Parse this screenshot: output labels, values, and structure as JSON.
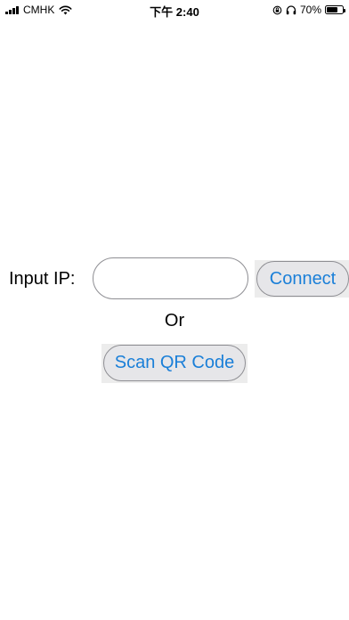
{
  "status_bar": {
    "carrier": "CMHK",
    "time": "下午 2:40",
    "battery_percent": "70%",
    "battery_level": 0.7,
    "icons": [
      "signal-icon",
      "wifi-icon",
      "orientation-lock-icon",
      "headphones-icon",
      "battery-icon"
    ]
  },
  "connect_form": {
    "ip_label": "Input IP:",
    "ip_value": "",
    "connect_label": "Connect"
  },
  "or_label": "Or",
  "scan_label": "Scan QR Code",
  "colors": {
    "button_text": "#1a7fd8",
    "button_bg": "#e6e6e9",
    "border": "#8e8e93"
  }
}
